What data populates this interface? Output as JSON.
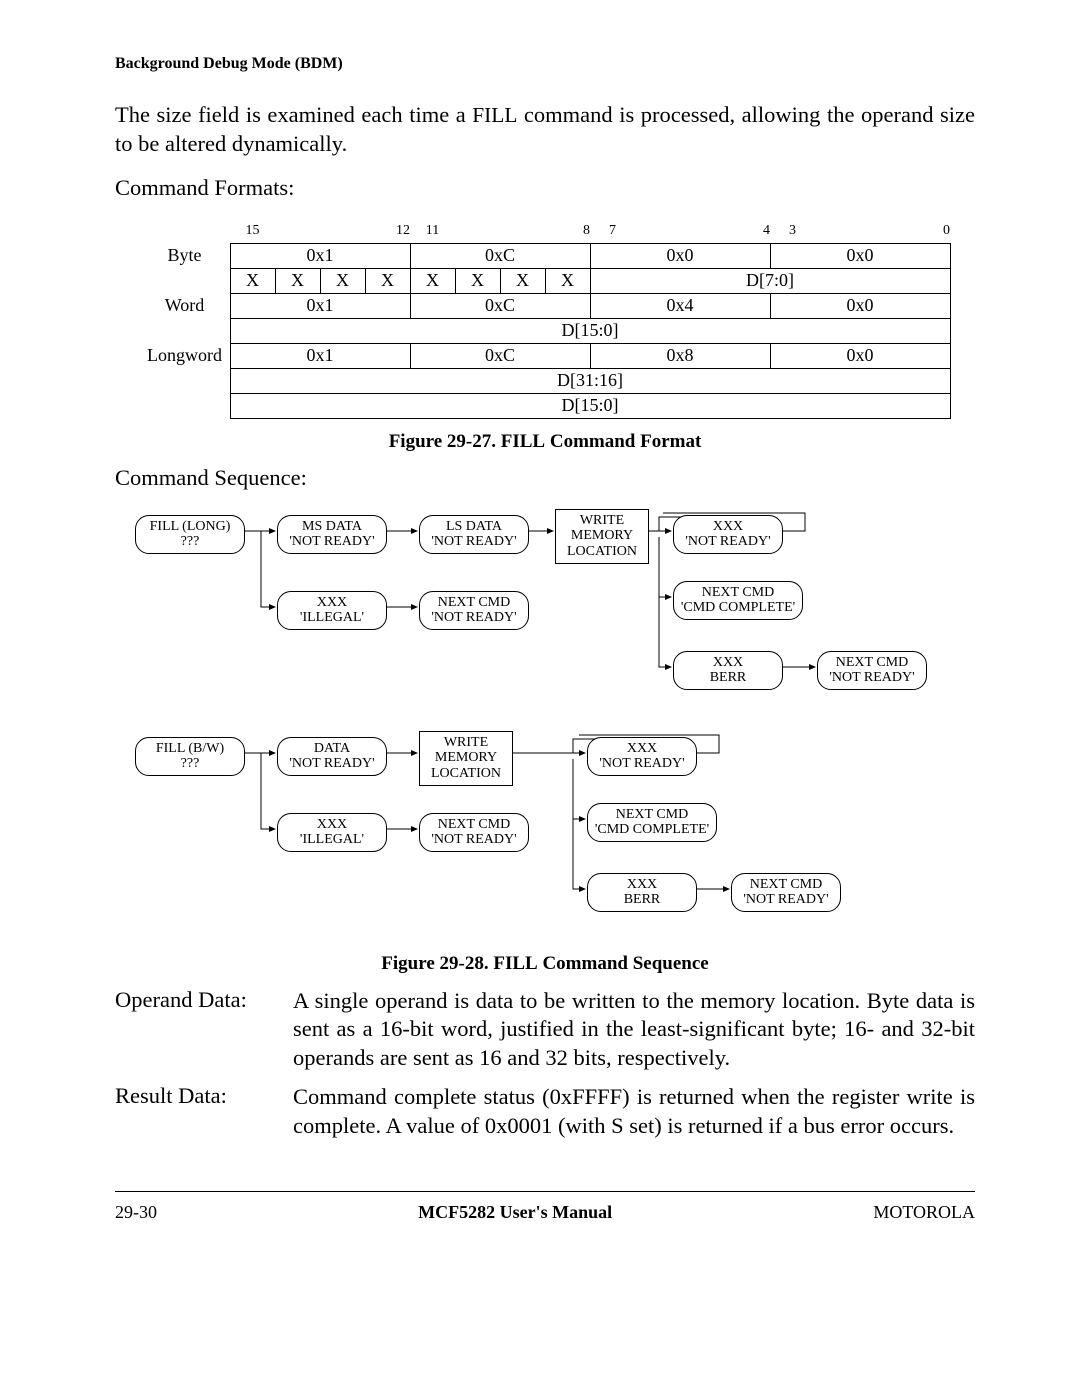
{
  "header": {
    "section": "Background Debug Mode (BDM)"
  },
  "intro": {
    "text1": "The size field is examined each time a ",
    "cmd1": "FILL",
    "text2": " command is processed, allowing the operand size to be altered dynamically."
  },
  "labels": {
    "command_formats": "Command Formats:",
    "command_sequence": "Command Sequence:"
  },
  "bitnums": [
    "15",
    "12",
    "11",
    "8",
    "7",
    "4",
    "3",
    "0"
  ],
  "table": {
    "rows": [
      {
        "label": "Byte",
        "cells": [
          {
            "span": 4,
            "v": "0x1"
          },
          {
            "span": 4,
            "v": "0xC"
          },
          {
            "span": 4,
            "v": "0x0"
          },
          {
            "span": 4,
            "v": "0x0"
          }
        ],
        "sub": [
          {
            "span": 1,
            "v": "X"
          },
          {
            "span": 1,
            "v": "X"
          },
          {
            "span": 1,
            "v": "X"
          },
          {
            "span": 1,
            "v": "X"
          },
          {
            "span": 1,
            "v": "X"
          },
          {
            "span": 1,
            "v": "X"
          },
          {
            "span": 1,
            "v": "X"
          },
          {
            "span": 1,
            "v": "X"
          },
          {
            "span": 8,
            "v": "D[7:0]"
          }
        ]
      },
      {
        "label": "Word",
        "cells": [
          {
            "span": 4,
            "v": "0x1"
          },
          {
            "span": 4,
            "v": "0xC"
          },
          {
            "span": 4,
            "v": "0x4"
          },
          {
            "span": 4,
            "v": "0x0"
          }
        ],
        "sub": [
          {
            "span": 16,
            "v": "D[15:0]"
          }
        ]
      },
      {
        "label": "Longword",
        "cells": [
          {
            "span": 4,
            "v": "0x1"
          },
          {
            "span": 4,
            "v": "0xC"
          },
          {
            "span": 4,
            "v": "0x8"
          },
          {
            "span": 4,
            "v": "0x0"
          }
        ],
        "sub": [
          {
            "span": 16,
            "v": "D[31:16]"
          }
        ],
        "sub2": [
          {
            "span": 16,
            "v": "D[15:0]"
          }
        ]
      }
    ]
  },
  "fig27": {
    "no": "Figure 29-27.  ",
    "cmd": "FILL",
    "suffix": " Command Format"
  },
  "fig28": {
    "no": "Figure 29-28. ",
    "cmd": "FILL",
    "suffix": " Command Sequence"
  },
  "diag1": {
    "n0a": "FILL (LONG)",
    "n0b": "???",
    "n1a": "MS DATA",
    "n1b": "'NOT READY'",
    "n2a": "LS DATA",
    "n2b": "'NOT READY'",
    "n3a": "WRITE",
    "n3b": "MEMORY",
    "n3c": "LOCATION",
    "n4a": "XXX",
    "n4b": "'NOT READY'",
    "n5a": "XXX",
    "n5b": "'ILLEGAL'",
    "n6a": "NEXT CMD",
    "n6b": "'NOT READY'",
    "n7a": "NEXT CMD",
    "n7b": "'CMD COMPLETE'",
    "n8a": "XXX",
    "n8b": "BERR",
    "n9a": "NEXT CMD",
    "n9b": "'NOT READY'"
  },
  "diag2": {
    "n0a": "FILL (B/W)",
    "n0b": "???",
    "n1a": "DATA",
    "n1b": "'NOT READY'",
    "n3a": "WRITE",
    "n3b": "MEMORY",
    "n3c": "LOCATION",
    "n4a": "XXX",
    "n4b": "'NOT READY'",
    "n5a": "XXX",
    "n5b": "'ILLEGAL'",
    "n6a": "NEXT CMD",
    "n6b": "'NOT READY'",
    "n7a": "NEXT CMD",
    "n7b": "'CMD COMPLETE'",
    "n8a": "XXX",
    "n8b": "BERR",
    "n9a": "NEXT CMD",
    "n9b": "'NOT READY'"
  },
  "operand": {
    "label": "Operand Data:",
    "body": "A single operand is data to be written to the memory location. Byte data is sent as a 16-bit word, justified in the least-significant byte; 16- and 32-bit operands are sent as 16 and 32 bits, respectively."
  },
  "result": {
    "label": "Result Data:",
    "body": "Command complete status (0xFFFF) is returned when the register write is complete. A value of 0x0001 (with S set) is returned if a bus error occurs."
  },
  "footer": {
    "left": "29-30",
    "mid": "MCF5282 User's Manual",
    "right": "MOTOROLA"
  }
}
